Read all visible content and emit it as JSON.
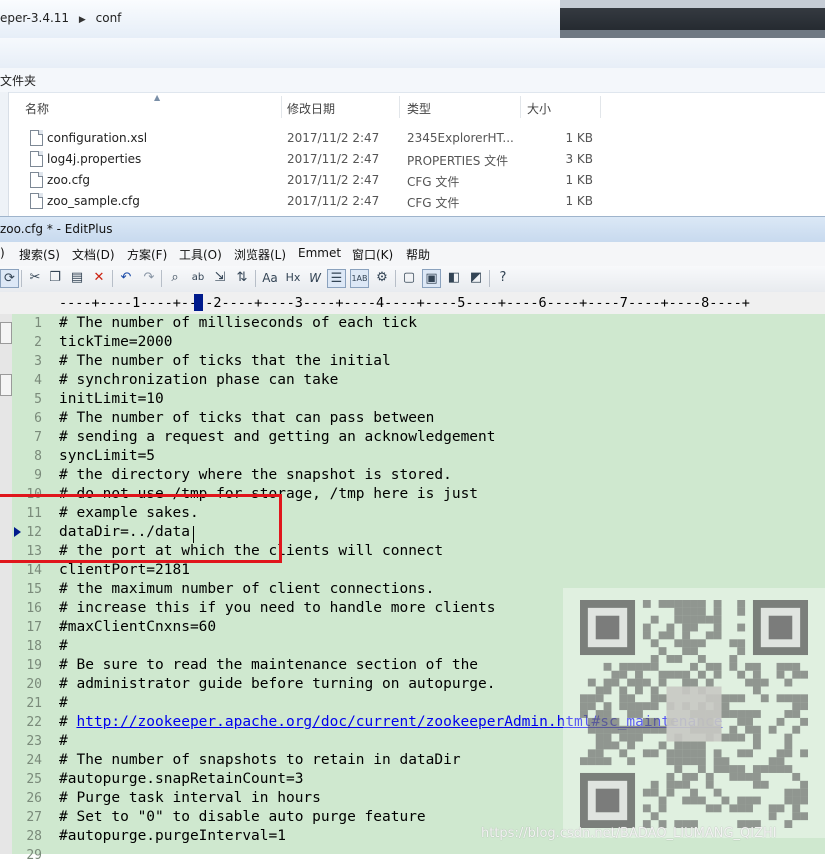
{
  "explorer": {
    "breadcrumb": [
      "eper-3.4.11",
      "conf"
    ],
    "folder_note": "文件夹",
    "columns": {
      "name": "名称",
      "date": "修改日期",
      "type": "类型",
      "size": "大小"
    },
    "files": [
      {
        "name": "configuration.xsl",
        "date": "2017/11/2 2:47",
        "type": "2345ExplorerHT...",
        "size": "1 KB"
      },
      {
        "name": "log4j.properties",
        "date": "2017/11/2 2:47",
        "type": "PROPERTIES 文件",
        "size": "3 KB"
      },
      {
        "name": "zoo.cfg",
        "date": "2017/11/2 2:47",
        "type": "CFG 文件",
        "size": "1 KB"
      },
      {
        "name": "zoo_sample.cfg",
        "date": "2017/11/2 2:47",
        "type": "CFG 文件",
        "size": "1 KB"
      }
    ]
  },
  "editplus": {
    "title": "zoo.cfg * - EditPlus",
    "menus": [
      ")",
      "搜索(S)",
      "文档(D)",
      "方案(F)",
      "工具(O)",
      "浏览器(L)",
      "Emmet",
      "窗口(K)",
      "帮助"
    ],
    "ruler": "----+----1----+----2----+----3----+----4----+----5----+----6----+----7----+----8----+",
    "lines": [
      {
        "n": "1",
        "text": "# The number of milliseconds of each tick"
      },
      {
        "n": "2",
        "text": "tickTime=2000"
      },
      {
        "n": "3",
        "text": "# The number of ticks that the initial"
      },
      {
        "n": "4",
        "text": "# synchronization phase can take"
      },
      {
        "n": "5",
        "text": "initLimit=10"
      },
      {
        "n": "6",
        "text": "# The number of ticks that can pass between"
      },
      {
        "n": "7",
        "text": "# sending a request and getting an acknowledgement"
      },
      {
        "n": "8",
        "text": "syncLimit=5"
      },
      {
        "n": "9",
        "text": "# the directory where the snapshot is stored."
      },
      {
        "n": "10",
        "text": "# do not use /tmp for storage, /tmp here is just"
      },
      {
        "n": "11",
        "text": "# example sakes."
      },
      {
        "n": "12",
        "text": "dataDir=../data"
      },
      {
        "n": "13",
        "text": "# the port at which the clients will connect"
      },
      {
        "n": "14",
        "text": "clientPort=2181"
      },
      {
        "n": "15",
        "text": "# the maximum number of client connections."
      },
      {
        "n": "16",
        "text": "# increase this if you need to handle more clients"
      },
      {
        "n": "17",
        "text": "#maxClientCnxns=60"
      },
      {
        "n": "18",
        "text": "#"
      },
      {
        "n": "19",
        "text": "# Be sure to read the maintenance section of the"
      },
      {
        "n": "20",
        "text": "# administrator guide before turning on autopurge."
      },
      {
        "n": "21",
        "text": "#"
      },
      {
        "n": "22",
        "text": "# ",
        "link": "http://zookeeper.apache.org/doc/current/zookeeperAdmin.html#sc_maintenance"
      },
      {
        "n": "23",
        "text": "#"
      },
      {
        "n": "24",
        "text": "# The number of snapshots to retain in dataDir"
      },
      {
        "n": "25",
        "text": "#autopurge.snapRetainCount=3"
      },
      {
        "n": "26",
        "text": "# Purge task interval in hours"
      },
      {
        "n": "27",
        "text": "# Set to \"0\" to disable auto purge feature"
      },
      {
        "n": "28",
        "text": "#autopurge.purgeInterval=1"
      },
      {
        "n": "29",
        "text": ""
      }
    ]
  },
  "watermark": "https://blog.csdn.net/BADAO_LIUMANG_QIZHI",
  "colors": {
    "editor_bg": "#cfe8cf",
    "highlight_box": "#e0161c",
    "link": "#0000ee"
  }
}
